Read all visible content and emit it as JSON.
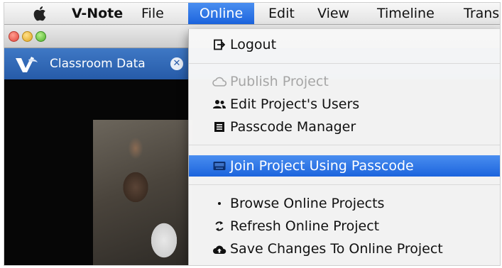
{
  "menubar": {
    "app_name": "V-Note",
    "items": [
      "File",
      "Online",
      "Edit",
      "View",
      "Timeline",
      "Trans"
    ],
    "active_item": "Online"
  },
  "tab": {
    "label": "Classroom Data",
    "close_glyph": "✕"
  },
  "online_menu": {
    "items": [
      {
        "label": "Logout",
        "icon": "logout-icon",
        "enabled": true
      },
      {
        "label": "Publish Project",
        "icon": "cloud-icon",
        "enabled": false
      },
      {
        "label": "Edit Project's Users",
        "icon": "users-icon",
        "enabled": true
      },
      {
        "label": "Passcode Manager",
        "icon": "list-icon",
        "enabled": true
      },
      {
        "label": "Join Project Using Passcode",
        "icon": "keyboard-icon",
        "enabled": true,
        "highlighted": true
      },
      {
        "label": "Browse Online Projects",
        "icon": "dot-icon",
        "enabled": true
      },
      {
        "label": "Refresh Online Project",
        "icon": "refresh-icon",
        "enabled": true
      },
      {
        "label": "Save Changes To Online Project",
        "icon": "cloud-upload-icon",
        "enabled": true
      }
    ]
  },
  "colors": {
    "menu_highlight": "#1c64dd",
    "tab_strip": "#2e67b5",
    "disabled_text": "#a6a6a6"
  }
}
